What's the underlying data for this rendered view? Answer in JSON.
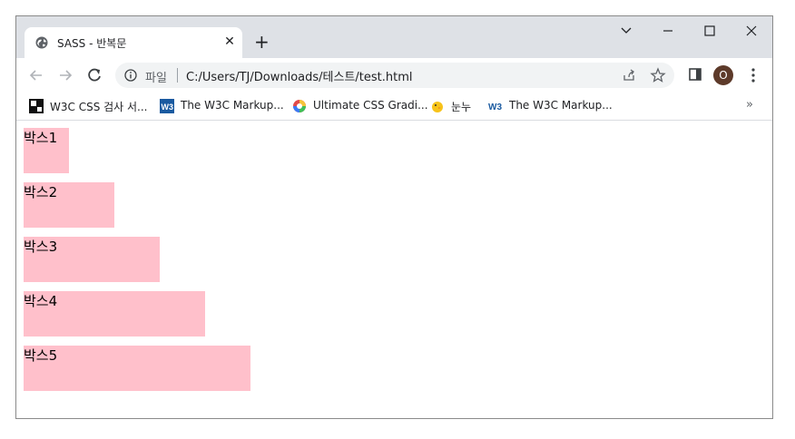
{
  "tab": {
    "title": "SASS - 반복문",
    "close": "✕"
  },
  "new_tab": "+",
  "omnibox": {
    "label": "파일",
    "url": "C:/Users/TJ/Downloads/테스트/test.html"
  },
  "profile": {
    "initial": "O",
    "color": "#5d3a2a"
  },
  "bookmarks": {
    "items": [
      {
        "label": "W3C CSS 검사 서...",
        "icon": "w3c-validator-icon"
      },
      {
        "label": "The W3C Markup...",
        "icon": "w3c-blue-icon"
      },
      {
        "label": "Ultimate CSS Gradi...",
        "icon": "gradient-wheel-icon"
      },
      {
        "label": "눈누",
        "icon": "noonnu-chick-icon"
      },
      {
        "label": "The W3C Markup...",
        "icon": "w3c-text-icon"
      }
    ],
    "overflow": "»"
  },
  "boxes": [
    {
      "label": "박스1",
      "width": 50
    },
    {
      "label": "박스2",
      "width": 100
    },
    {
      "label": "박스3",
      "width": 150
    },
    {
      "label": "박스4",
      "width": 200
    },
    {
      "label": "박스5",
      "width": 250
    }
  ],
  "colors": {
    "box_bg": "#ffc0cb",
    "titlebar": "#dee1e6",
    "omnibox": "#f1f3f4"
  }
}
